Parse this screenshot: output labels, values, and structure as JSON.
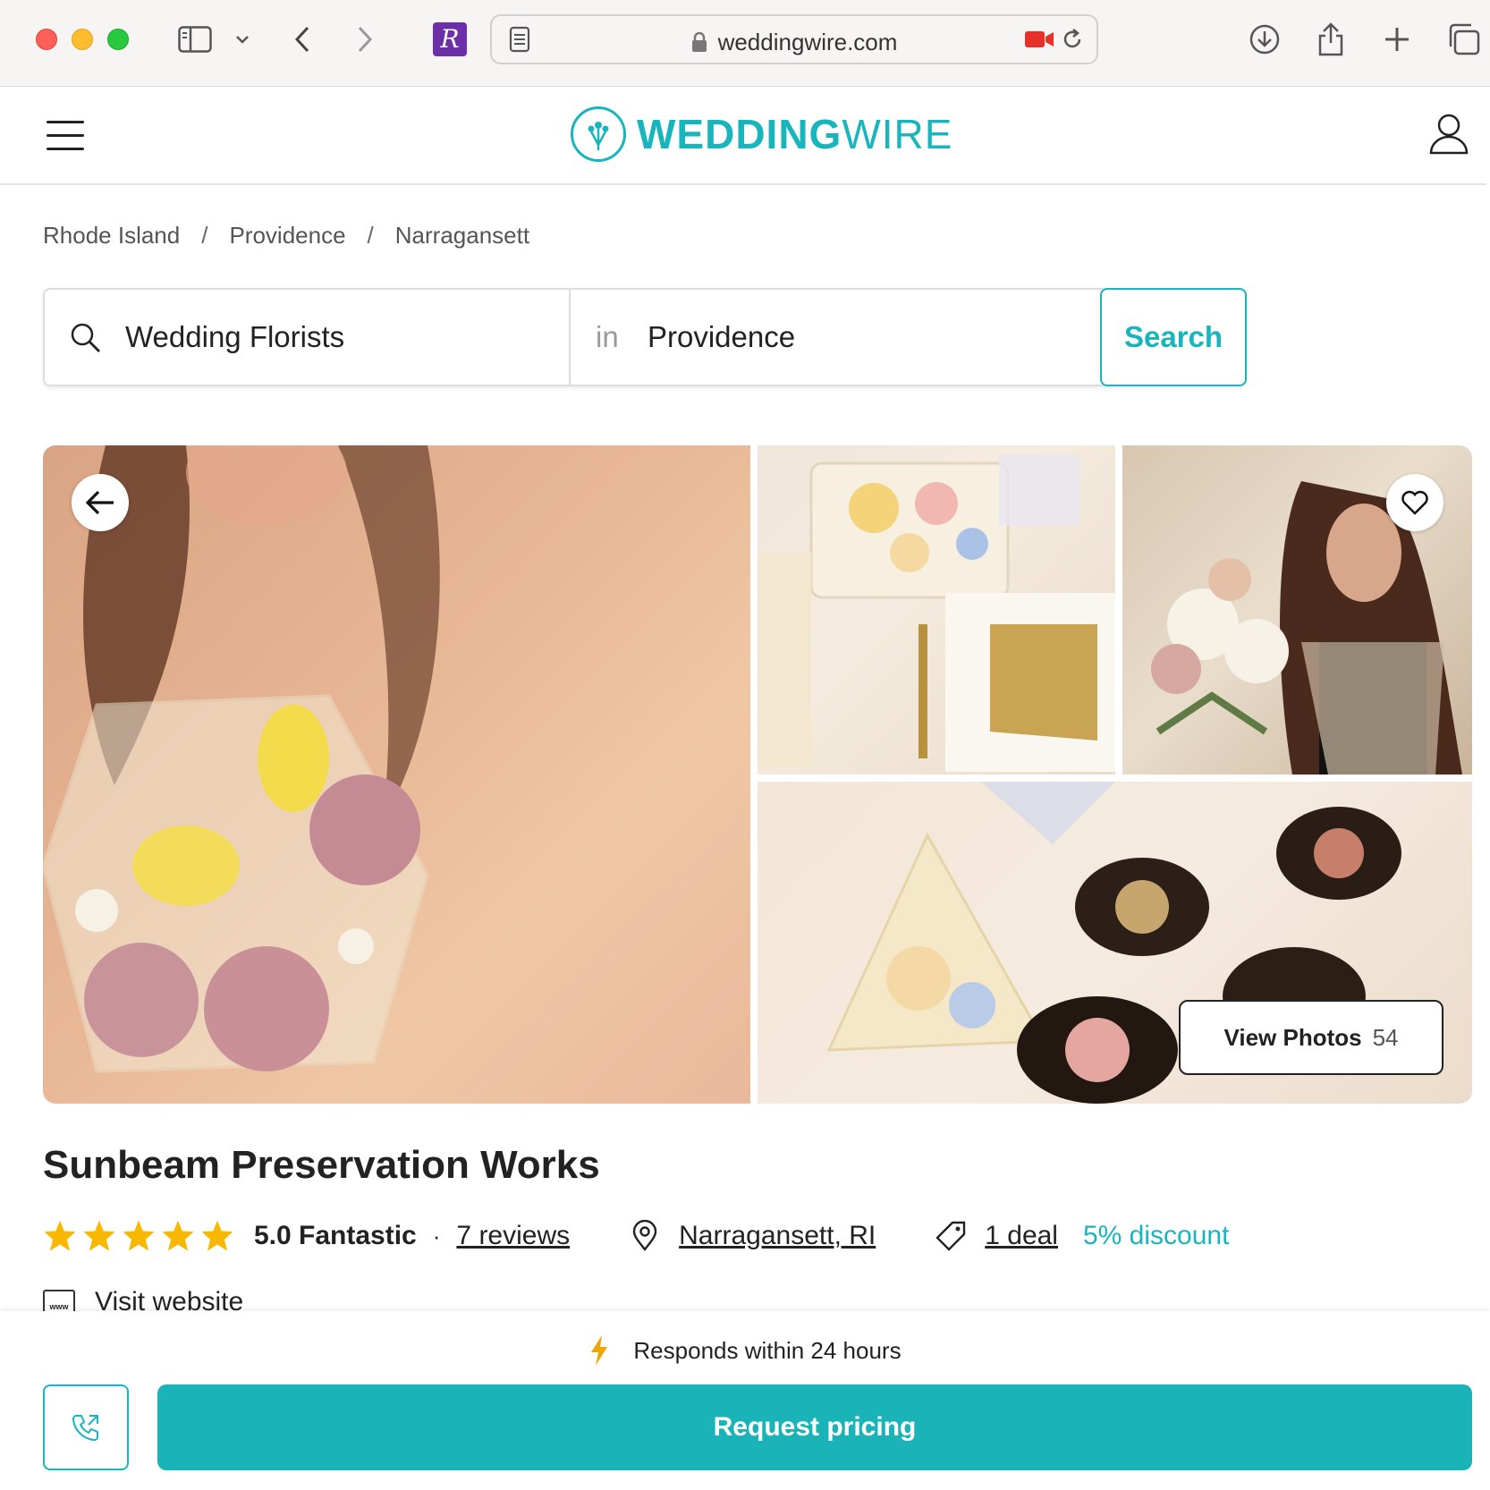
{
  "browser": {
    "url": "weddingwire.com",
    "extension_letter": "R"
  },
  "header": {
    "logo_bold": "WEDDING",
    "logo_light": "WIRE",
    "brand_color": "#19b5bc"
  },
  "breadcrumb": [
    "Rhode Island",
    "Providence",
    "Narragansett"
  ],
  "search": {
    "category_value": "Wedding Florists",
    "in_label": "in",
    "location_value": "Providence",
    "button_label": "Search"
  },
  "gallery": {
    "view_photos_label": "View Photos",
    "photo_count": "54"
  },
  "vendor": {
    "name": "Sunbeam Preservation Works",
    "stars": 5,
    "rating_text": "5.0 Fantastic",
    "reviews_link": "7 reviews",
    "location_link": "Narragansett, RI",
    "deal_link": "1 deal",
    "discount": "5% discount",
    "website_label": "Visit website",
    "website_icon_text": "www"
  },
  "cta": {
    "responds_text": "Responds within 24 hours",
    "request_button": "Request pricing",
    "accent_color": "#1ab3b8",
    "star_color": "#f8b800"
  }
}
